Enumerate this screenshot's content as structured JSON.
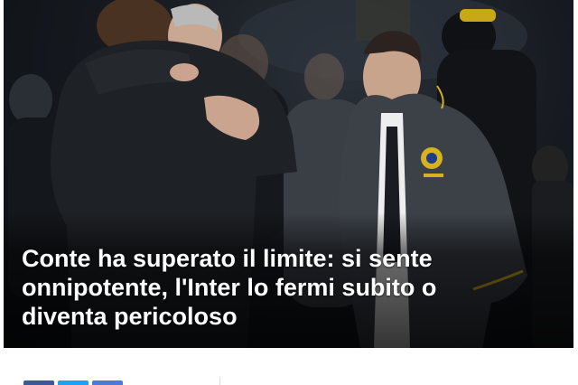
{
  "article": {
    "title": "Conte ha superato il limite: si sente onnipotente, l'Inter lo fermi subito o diventa pericoloso"
  },
  "photo": {
    "subject": "two football coaches after a match, one embracing a colleague, the other walking in an Inter jacket",
    "badge_icon": "inter-crest-icon"
  },
  "share": {
    "buttons": [
      {
        "name": "facebook",
        "icon": "facebook-icon",
        "color": "#3b5998"
      },
      {
        "name": "twitter",
        "icon": "twitter-icon",
        "color": "#1da1f2"
      },
      {
        "name": "email",
        "icon": "email-icon",
        "color": "#4b7bd6"
      }
    ]
  },
  "colors": {
    "title_text": "#ffffff",
    "jacket_dark": "#1e2125",
    "jacket_grey": "#3c4148",
    "crest_gold": "#d6b21e"
  }
}
